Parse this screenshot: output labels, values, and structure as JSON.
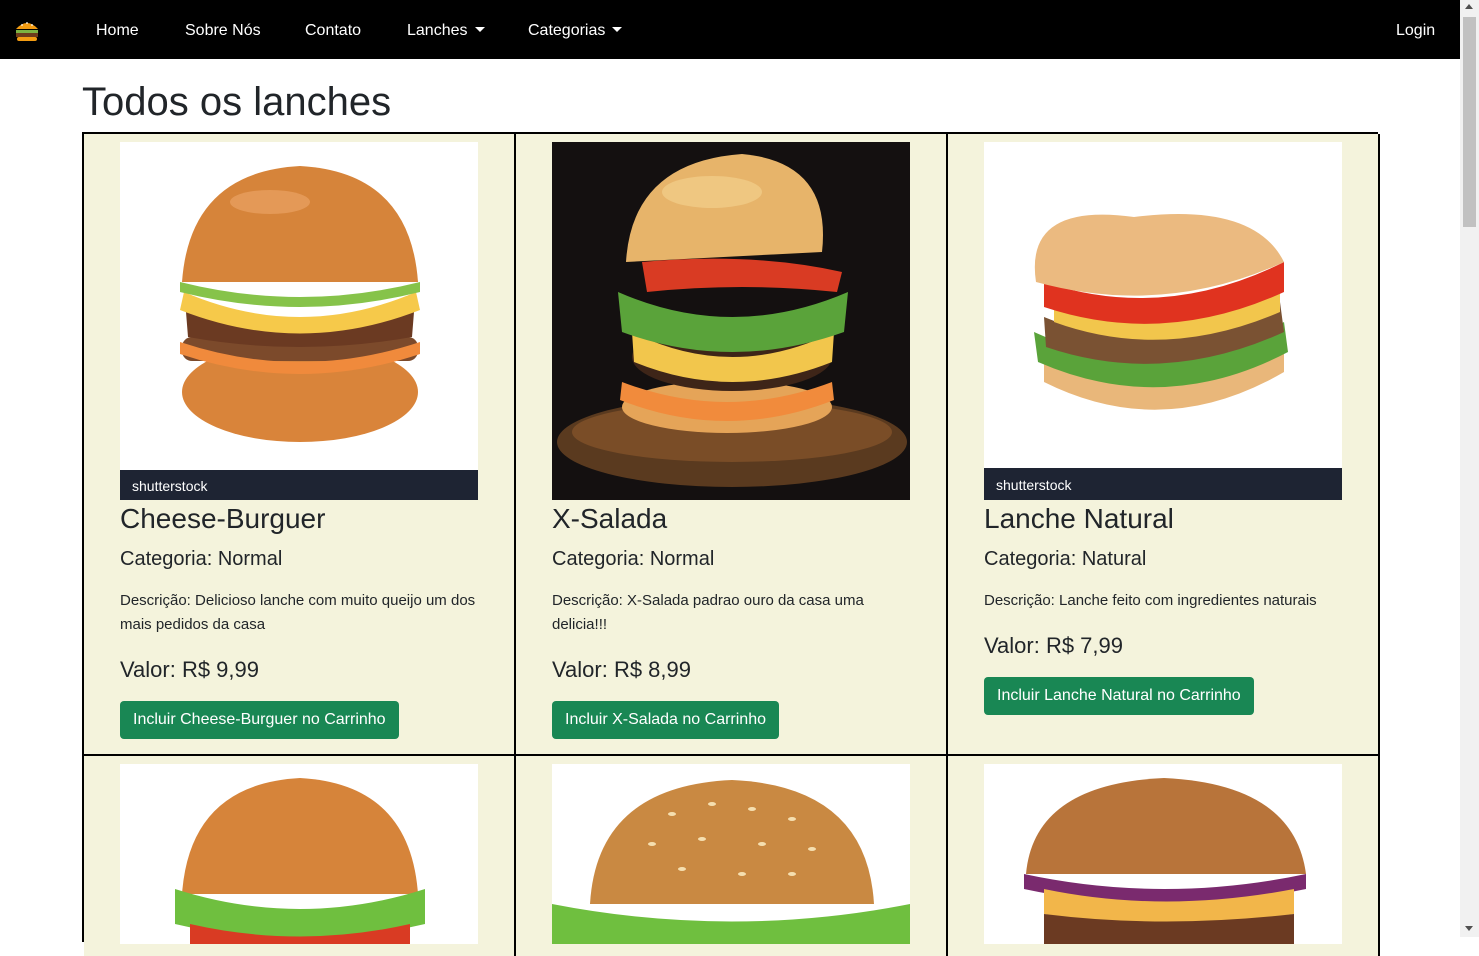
{
  "navbar": {
    "brand_icon": "burger-logo-icon",
    "links": [
      {
        "label": "Home"
      },
      {
        "label": "Sobre Nós"
      },
      {
        "label": "Contato"
      },
      {
        "label": "Lanches"
      },
      {
        "label": "Categorias"
      }
    ],
    "login_label": "Login"
  },
  "page": {
    "title": "Todos os lanches"
  },
  "lanches": [
    {
      "name": "Cheese-Burguer",
      "category": "Categoria: Normal",
      "description": "Descrição: Delicioso lanche com muito queijo um dos mais pedidos da casa",
      "price": "Valor: R$ 9,99",
      "button": "Incluir Cheese-Burguer no Carrinho",
      "image_watermark": "shutterstock"
    },
    {
      "name": "X-Salada",
      "category": "Categoria: Normal",
      "description": "Descrição: X-Salada padrao ouro da casa uma delicia!!!",
      "price": "Valor: R$ 8,99",
      "button": "Incluir X-Salada no Carrinho"
    },
    {
      "name": "Lanche Natural",
      "category": "Categoria: Natural",
      "description": "Descrição: Lanche feito com ingredientes naturais",
      "price": "Valor: R$ 7,99",
      "button": "Incluir Lanche Natural no Carrinho",
      "image_watermark": "shutterstock"
    }
  ],
  "colors": {
    "navbar": "#000000",
    "card_background": "#f4f3dc",
    "button": "#198754"
  }
}
